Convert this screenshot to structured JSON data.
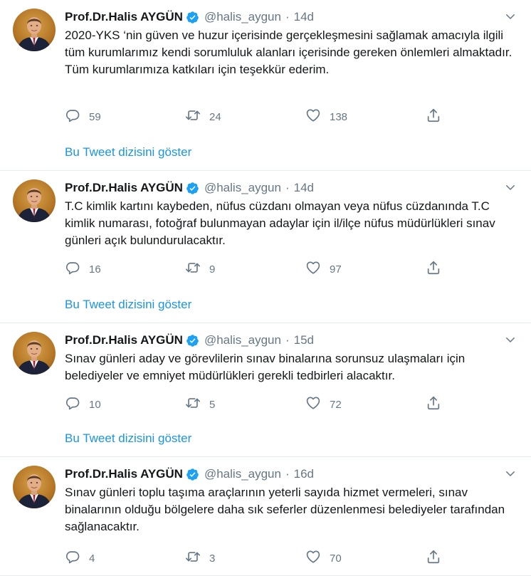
{
  "tweets": [
    {
      "name": "Prof.Dr.Halis AYGÜN",
      "handle": "@halis_aygun",
      "time": "14d",
      "text": "2020-YKS ‘nin güven ve huzur içerisinde gerçekleşmesini sağlamak amacıyla ilgili tüm kurumlarımız kendi sorumluluk alanları içerisinde gereken önlemleri almaktadır.\nTüm kurumlarımıza katkıları için teşekkür ederim.",
      "replies": "59",
      "retweets": "24",
      "likes": "138",
      "show_thread": "Bu Tweet dizisini göster"
    },
    {
      "name": "Prof.Dr.Halis AYGÜN",
      "handle": "@halis_aygun",
      "time": "14d",
      "text": "T.C kimlik kartını kaybeden, nüfus cüzdanı olmayan veya nüfus cüzdanında T.C kimlik numarası, fotoğraf bulunmayan adaylar için il/ilçe nüfus müdürlükleri sınav günleri açık bulundurulacaktır.",
      "replies": "16",
      "retweets": "9",
      "likes": "97",
      "show_thread": "Bu Tweet dizisini göster"
    },
    {
      "name": "Prof.Dr.Halis AYGÜN",
      "handle": "@halis_aygun",
      "time": "15d",
      "text": "Sınav günleri aday ve görevlilerin sınav binalarına sorunsuz ulaşmaları için belediyeler ve emniyet müdürlükleri gerekli tedbirleri alacaktır.",
      "replies": "10",
      "retweets": "5",
      "likes": "72",
      "show_thread": "Bu Tweet dizisini göster"
    },
    {
      "name": "Prof.Dr.Halis AYGÜN",
      "handle": "@halis_aygun",
      "time": "16d",
      "text": "Sınav günleri toplu taşıma araçlarının yeterli sayıda hizmet vermeleri, sınav binalarının olduğu bölgelere daha sık seferler düzenlenmesi belediyeler tarafından sağlanacaktır.",
      "replies": "4",
      "retweets": "3",
      "likes": "70"
    }
  ],
  "icons": {
    "verified": "verified-badge-icon",
    "caret": "chevron-down-icon",
    "reply": "reply-icon",
    "retweet": "retweet-icon",
    "like": "heart-icon",
    "share": "share-icon"
  },
  "colors": {
    "link": "#1b95e0",
    "secondary_text": "#657786",
    "verified": "#1da1f2",
    "divider": "#e6ecf0"
  }
}
